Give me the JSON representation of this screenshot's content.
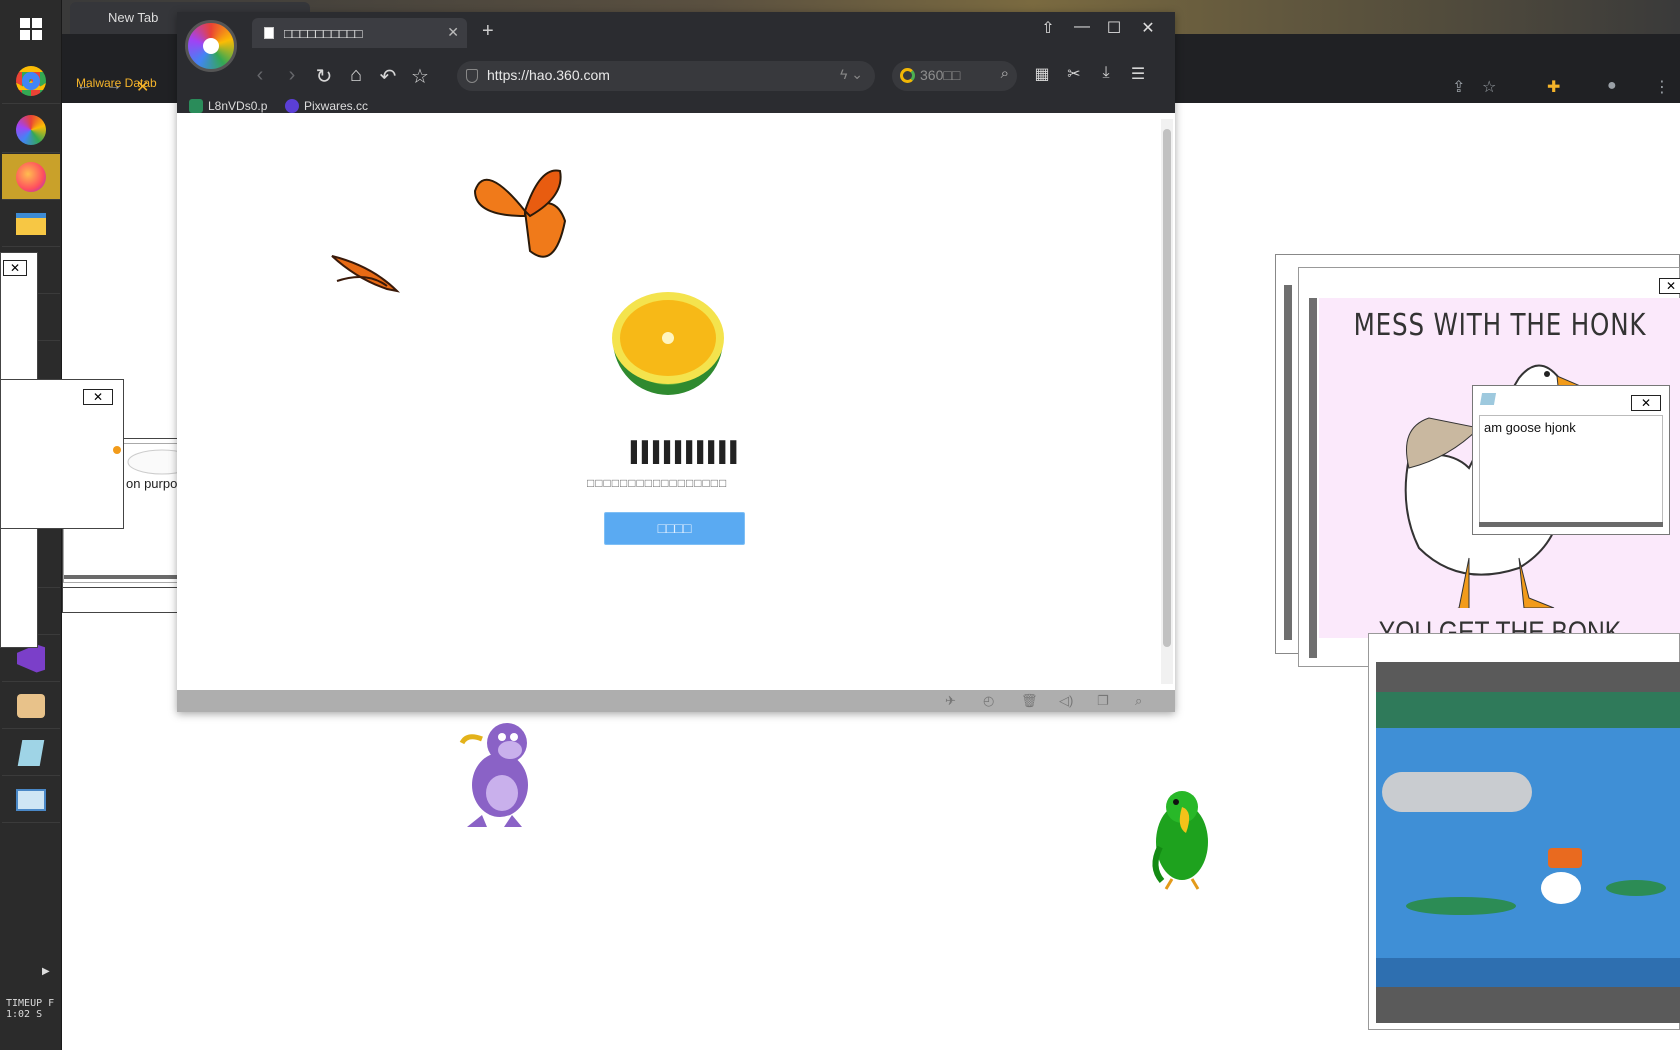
{
  "taskbar": {
    "clock_label": "TIMEUP F",
    "clock_time": "1:02  S"
  },
  "background_browser": {
    "tab_title": "New Tab",
    "bookmark": "Malware Datab"
  },
  "browser360": {
    "tab_title": "□□□□□□□□□□",
    "url": "https://hao.360.com",
    "search_placeholder": "360□□",
    "bookmarks": [
      {
        "label": "L8nVDs0.p",
        "color": "#2a8c5a"
      },
      {
        "label": "Pixwares.cc",
        "color": "#5b3fd6"
      }
    ],
    "loader": {
      "progress": "▌▌▌▌▌▌▌▌▌▌",
      "text": "□□□□□□□□□□□□□□□□□",
      "button": "□□□□"
    }
  },
  "popups": {
    "left_popup_text": "on purpose",
    "honk_title": "MESS WITH THE HONK",
    "honk_subtitle": "YOU GET THE BONK",
    "goose_note": "am goose hjonk"
  },
  "colors": {
    "loader_button": "#5aaaf2",
    "taskbar": "#2b2b2b",
    "browser_frame": "#2b2c30"
  }
}
